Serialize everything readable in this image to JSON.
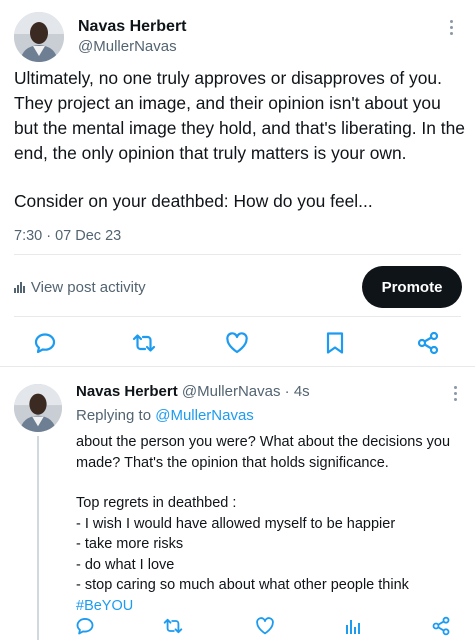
{
  "main_post": {
    "author_name": "Navas Herbert",
    "author_handle": "@MullerNavas",
    "paragraph_1": "Ultimately, no one truly approves or disapproves of you. They project an image, and their opinion isn't about you but the mental image they hold, and that's liberating. In the end, the only opinion that truly matters is your own.",
    "paragraph_2": "Consider on your deathbed: How do you feel...",
    "timestamp": "7:30 · 07 Dec 23",
    "activity_label": "View post activity",
    "promote_label": "Promote"
  },
  "actions": [
    "reply-icon",
    "repost-icon",
    "like-icon",
    "bookmark-icon",
    "share-icon"
  ],
  "reply_post": {
    "author_name": "Navas Herbert",
    "author_handle": "@MullerNavas",
    "time_ago": "· 4s",
    "replying_prefix": "Replying to",
    "replying_to": "@MullerNavas",
    "paragraph_1": "about the person you were? What about the decisions you made? That's the opinion that holds significance.",
    "list_title": "Top regrets in deathbed :",
    "regrets": [
      "- I wish I would have allowed myself to be happier",
      "- take more risks",
      "- do what I love",
      "- stop caring so much about what other people think"
    ],
    "hashtag": "#BeYOU"
  },
  "reply_actions": [
    "reply-icon",
    "repost-icon",
    "like-icon",
    "views-icon",
    "share-icon"
  ],
  "colors": {
    "text": "#0f1419",
    "secondary": "#536471",
    "link": "#1d9bf0",
    "button": "#0f1419",
    "divider": "#e7e9ea"
  }
}
